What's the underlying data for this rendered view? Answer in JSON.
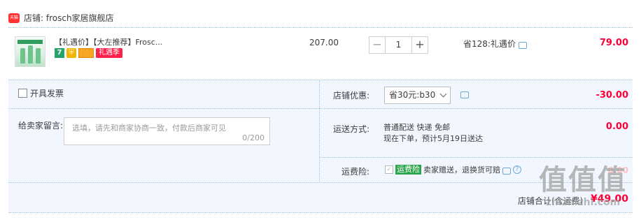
{
  "store": {
    "badge": "天猫",
    "name": "店铺: frosch家居旗舰店"
  },
  "item": {
    "title": "【礼遇价】【大左推荐】Frosc...",
    "icons": [
      "7",
      "shield",
      "card"
    ],
    "promo_tag": "礼遇季",
    "unit_price": "207.00",
    "quantity": "1",
    "minus_label": "−",
    "plus_label": "+",
    "save_text": "省128:礼遇价",
    "total": "79.00"
  },
  "invoice": {
    "label": "开具发票"
  },
  "message": {
    "label": "给卖家留言:",
    "placeholder": "选填，请先和商家协商一致，付款后商家可见",
    "counter": "0/200"
  },
  "coupon": {
    "label": "店铺优惠:",
    "selected": "省30元:b30",
    "amount": "-30.00"
  },
  "shipping": {
    "label": "运送方式:",
    "method_line1": "普通配送 快递 免邮",
    "method_line2": "现在下单，预计5月19日送达",
    "amount": "0.00"
  },
  "insurance": {
    "label": "运费险:",
    "check_mark": "✓",
    "tag": "运费险",
    "text": "卖家赠送，退换货可赔",
    "help": "?",
    "amount": "0.00"
  },
  "subtotal": {
    "label": "店铺合计(含运费)",
    "value": "¥49.00"
  },
  "watermark": {
    "big": "值值值",
    "small": "zhizhizhi.com"
  },
  "colors": {
    "price_red": "#ff0036",
    "panel_bg": "#f2f7ff",
    "divider": "#9fc3d8"
  }
}
